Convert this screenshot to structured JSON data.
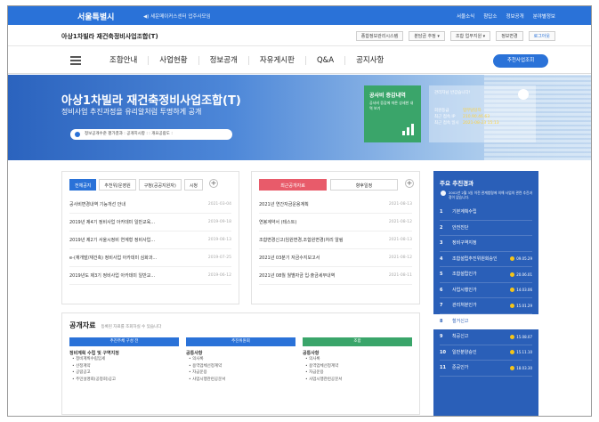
{
  "topbar": {
    "logo": "서울특별시",
    "notice": "◀) 세운메이커스센터 업주사모임",
    "links": [
      "서울소식",
      "참답소",
      "정보공개",
      "분야별정보"
    ]
  },
  "subbar": {
    "title": "아상1차빌라 재건축정비사업조합(T)",
    "tools": [
      "종합정보관리시스템",
      "분담금 추정 ▾",
      "조합 업무지원 ▾",
      "정보변경",
      "로그아웃"
    ]
  },
  "nav": {
    "items": [
      "조합안내",
      "사업현황",
      "정보공개",
      "자유게시판",
      "Q&A",
      "공지사항"
    ],
    "cta": "추천사업조회"
  },
  "hero": {
    "title": "아상1차빌라 재건축정비사업조합(T)",
    "subtitle": "정비사업 추진과정을 유리알처럼 투명하게 공개",
    "status": "정보공개수준 평가결과 : 공개지시항 :  : 개요공람도 :"
  },
  "info": {
    "title": "공사비 증감내역",
    "desc": "공사비 증감에 따른 상세한 내역 보기"
  },
  "user": {
    "hello": "관리자님 반갑습니다!",
    "rows": [
      [
        "회원등급",
        "업무담당자"
      ],
      [
        "최근 접속 IP",
        "210.90.46.63"
      ],
      [
        "최근 접속 일시",
        "2021-08-23 15:13"
      ]
    ]
  },
  "panel1": {
    "tabs": [
      "전체공지",
      "추천위/운영원",
      "구청(공공지원자)",
      "시청"
    ],
    "rows": [
      {
        "t": "공사비변경내역 기능개선 안내",
        "d": "2021-03-04"
      },
      {
        "t": "2019년 제4기 정비사업 아카데미 일반교육...",
        "d": "2019-09-18"
      },
      {
        "t": "2019년 제2기 서울시정비 연계형 정비사업...",
        "d": "2019-08-13"
      },
      {
        "t": "e-(재개발/재건축) 정비사업 아카데미 심화과...",
        "d": "2019-07-25"
      },
      {
        "t": "2019년도 제3기 정비사업 아카데미 일반교...",
        "d": "2019-06-12"
      }
    ]
  },
  "panel2": {
    "tabs": [
      "최근공개자료",
      "향후일정"
    ],
    "rows": [
      {
        "t": "2021년 연간자금운용계획",
        "d": "2021-08-13"
      },
      {
        "t": "연봉계약서 (테스트)",
        "d": "2021-08-12"
      },
      {
        "t": "조합변경신고(임원변경,조합원변경)처리 알림",
        "d": "2021-08-13"
      },
      {
        "t": "2021년 03분기 자금수지보고서",
        "d": "2021-08-12"
      },
      {
        "t": "2021년 08월 월별자금 입·출금세부내역",
        "d": "2021-08-11"
      }
    ]
  },
  "boards": {
    "title": "공개자료",
    "desc": "등록된 자료를 조회하실 수 있습니다",
    "cols": [
      {
        "head": "추진주체 구성 전",
        "color": "#2a72d8",
        "sub": "정비계획 수립 및 구역지정",
        "items": [
          "정비계획수립입세",
          "산정계약",
          "공람공고",
          "주민설명회(공청회)공고"
        ]
      },
      {
        "head": "추진위원회",
        "color": "#2a72d8",
        "sub": "공통사항",
        "items": [
          "의사록",
          "용역업체선정계약",
          "자금운용",
          "사업시행관련공문서"
        ]
      },
      {
        "head": "조합",
        "color": "#3aa56a",
        "sub": "공통사항",
        "items": [
          "의사록",
          "용역업체선정계약",
          "자금운용",
          "사업시행관련공문서"
        ]
      }
    ]
  },
  "side": {
    "title": "주요 추진경과",
    "note": "2002년 2월 3일 이전 관계법령에 의해 사업의 관련 추진과정이 없습니다.",
    "steps": [
      {
        "n": "1",
        "l": "기본계획수립",
        "d": ""
      },
      {
        "n": "2",
        "l": "안전진단",
        "d": ""
      },
      {
        "n": "3",
        "l": "정비구역지정",
        "d": ""
      },
      {
        "n": "4",
        "l": "조합설립추진위원회승인",
        "d": "09.05.29"
      },
      {
        "n": "5",
        "l": "조합설립인가",
        "d": "20.06.01"
      },
      {
        "n": "6",
        "l": "사업시행인가",
        "d": "14.03.06"
      },
      {
        "n": "7",
        "l": "관리처분인가",
        "d": "15.01.29"
      },
      {
        "n": "8",
        "l": "철거신고",
        "d": ""
      },
      {
        "n": "9",
        "l": "착공신고",
        "d": "15.08.07"
      },
      {
        "n": "10",
        "l": "일반분양승인",
        "d": "15.11.10"
      },
      {
        "n": "11",
        "l": "준공인가",
        "d": "18.03.30"
      }
    ]
  }
}
